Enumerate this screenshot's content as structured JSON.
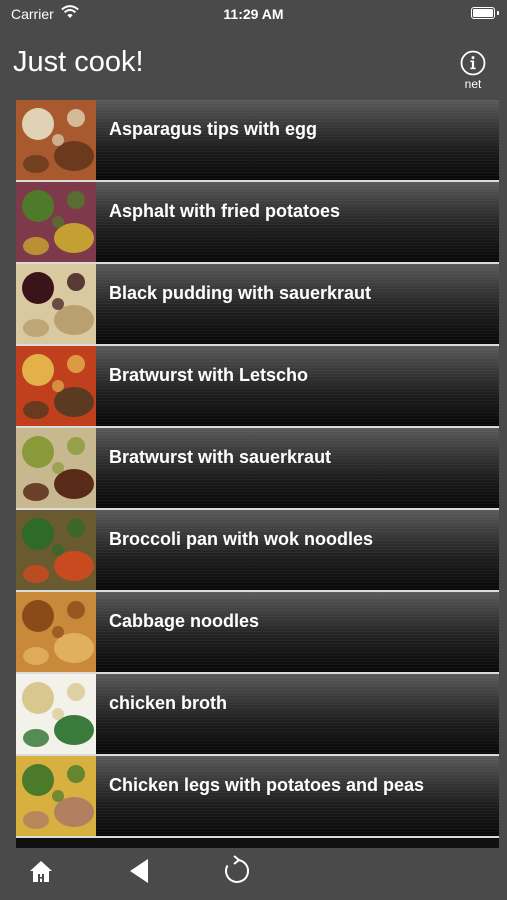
{
  "status_bar": {
    "carrier": "Carrier",
    "time": "11:29 AM",
    "icons": [
      "wifi-icon",
      "battery-icon"
    ]
  },
  "nav_bar": {
    "title": "Just cook!",
    "info_button_label": "net",
    "info_icon": "info-circle-icon"
  },
  "recipes": [
    {
      "name": "Asparagus tips with egg",
      "thumb_colors": [
        "#a85a2e",
        "#e0d2b4",
        "#6b3a1e"
      ]
    },
    {
      "name": "Asphalt with fried potatoes",
      "thumb_colors": [
        "#7e3a4a",
        "#4f7a2a",
        "#c4a032"
      ]
    },
    {
      "name": "Black pudding with sauerkraut",
      "thumb_colors": [
        "#d9c9a0",
        "#3a1418",
        "#b8a070"
      ]
    },
    {
      "name": "Bratwurst with Letscho",
      "thumb_colors": [
        "#c0401e",
        "#e3b04a",
        "#5a3a20"
      ]
    },
    {
      "name": "Bratwurst with sauerkraut",
      "thumb_colors": [
        "#c8b890",
        "#8a9a3a",
        "#5a2a18"
      ]
    },
    {
      "name": "Broccoli pan with wok noodles",
      "thumb_colors": [
        "#6a5a30",
        "#2f6a2a",
        "#c84a20"
      ]
    },
    {
      "name": "Cabbage noodles",
      "thumb_colors": [
        "#c88a3a",
        "#8a4a1a",
        "#e0b060"
      ]
    },
    {
      "name": "chicken broth",
      "thumb_colors": [
        "#f2f2ea",
        "#d8c890",
        "#3a7a3a"
      ]
    },
    {
      "name": "Chicken legs with potatoes and peas",
      "thumb_colors": [
        "#d8b040",
        "#4a7a2a",
        "#b08060"
      ]
    }
  ],
  "tab_bar": {
    "items": [
      "home-icon",
      "back-arrow-icon",
      "refresh-icon"
    ]
  }
}
